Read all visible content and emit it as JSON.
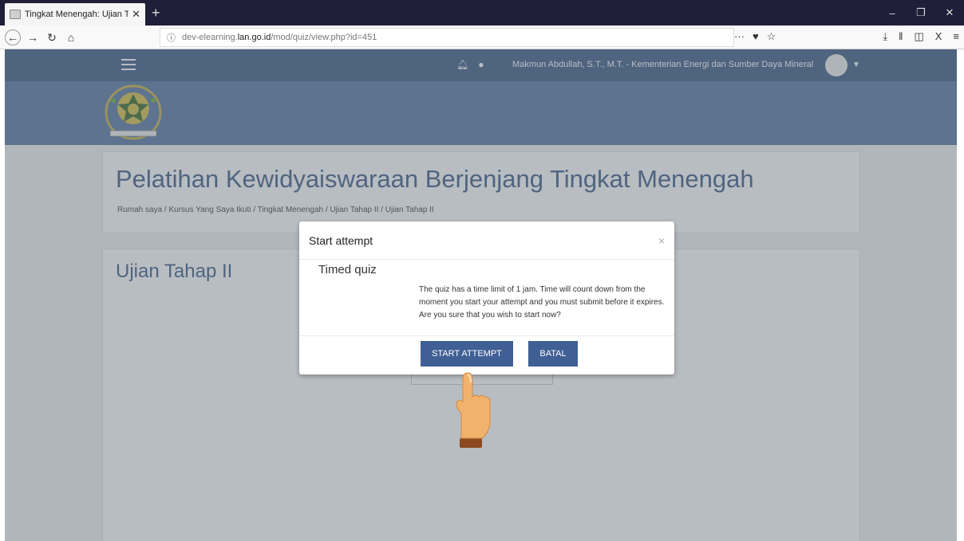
{
  "browser": {
    "tab_title": "Tingkat Menengah: Ujian Tahap",
    "tab_close": "✕",
    "new_tab": "+",
    "url_prefix": "dev-elearning.",
    "url_domain": "lan.go.id",
    "url_path": "/mod/quiz/view.php?id=451",
    "url_more": "···"
  },
  "topbar": {
    "user_name": "Makmun Abdullah, S.T., M.T. - Kementerian Energi dan Sumber Daya Mineral"
  },
  "course": {
    "title": "Pelatihan Kewidyaiswaraan Berjenjang Tingkat Menengah",
    "breadcrumb": "Rumah saya / Kursus Yang Saya Ikuti / Tingkat Menengah / Ujian Tahap II / Ujian Tahap II"
  },
  "quiz": {
    "heading": "Ujian Tahap II"
  },
  "modal": {
    "title": "Start attempt",
    "close": "×",
    "heading": "Timed quiz",
    "message": "The quiz has a time limit of 1 jam. Time will count down from the moment you start your attempt and you must submit before it expires. Are you sure that you wish to start now?",
    "start_label": "START ATTEMPT",
    "cancel_label": "BATAL"
  },
  "colors": {
    "navbar": "#405d86",
    "header": "#5a78a2",
    "button": "#3f5f95"
  }
}
